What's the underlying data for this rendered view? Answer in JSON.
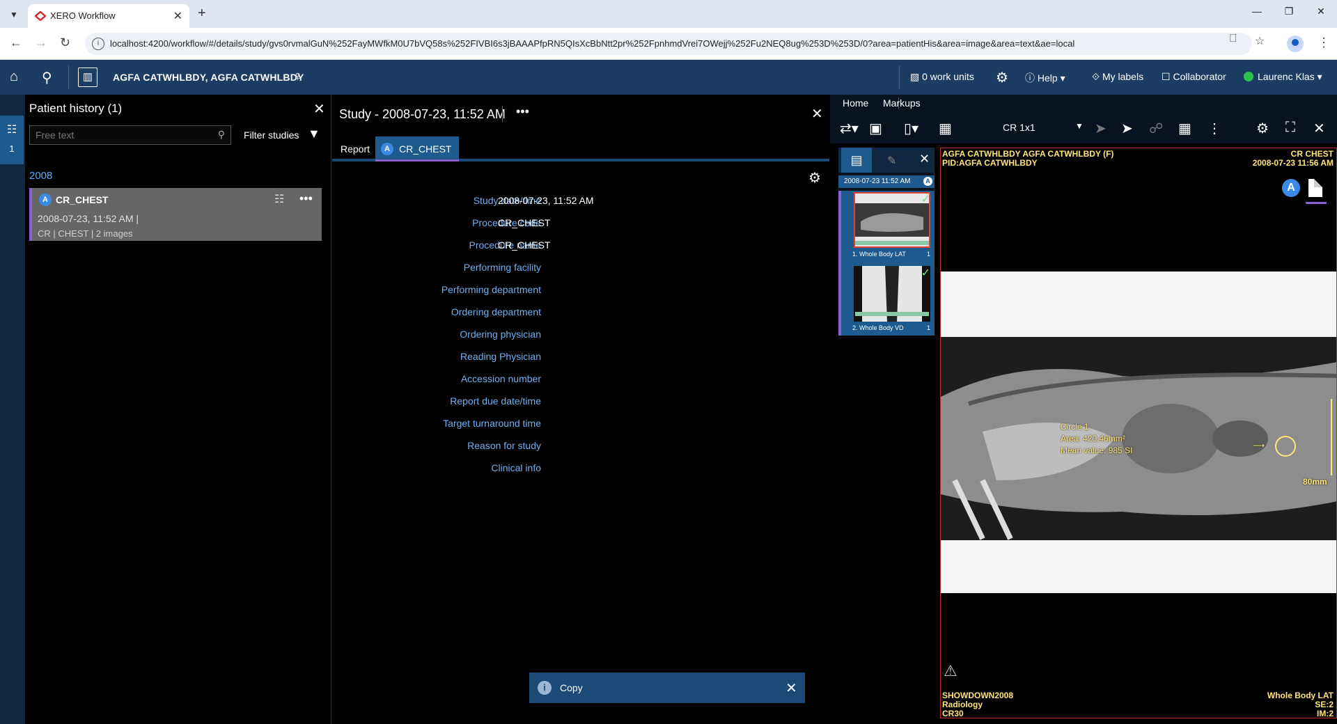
{
  "browser": {
    "tab_title": "XERO Workflow",
    "url": "localhost:4200/workflow/#/details/study/gvs0rvmalGuN%252FayMWfkM0U7bVQ58s%252FIVBI6s3jBAAAPfpRN5QIsXcBbNtt2pr%252FpnhmdVrei7OWejj%252Fu2NEQ8ug%253D%253D/0?area=patientHis&area=image&area=text&ae=local"
  },
  "header": {
    "patient_name": "AGFA CATWHLBDY, AGFA CATWHLBDY",
    "work_units": "0 work units",
    "help": "Help",
    "my_labels": "My labels",
    "collaborator": "Collaborator",
    "user": "Laurenc Klas"
  },
  "rail": {
    "count": "1"
  },
  "history": {
    "title": "Patient history (1)",
    "search_placeholder": "Free text",
    "filter_label": "Filter studies",
    "year": "2008",
    "study": {
      "badge": "A",
      "name": "CR_CHEST",
      "date": "2008-07-23, 11:52 AM |",
      "meta": "CR | CHEST | 2 images"
    }
  },
  "study": {
    "title": "Study - 2008-07-23, 11:52 AM",
    "tab_report": "Report",
    "tab_badge": "A",
    "tab_name": "CR_CHEST",
    "fields": [
      {
        "label": "Study date/time",
        "value": "2008-07-23, 11:52 AM"
      },
      {
        "label": "Procedure code",
        "value": "CR_CHEST"
      },
      {
        "label": "Procedure name",
        "value": "CR_CHEST"
      },
      {
        "label": "Performing facility",
        "value": ""
      },
      {
        "label": "Performing department",
        "value": ""
      },
      {
        "label": "Ordering department",
        "value": ""
      },
      {
        "label": "Ordering physician",
        "value": ""
      },
      {
        "label": "Reading Physician",
        "value": ""
      },
      {
        "label": "Accession number",
        "value": ""
      },
      {
        "label": "Report due date/time",
        "value": ""
      },
      {
        "label": "Target turnaround time",
        "value": ""
      },
      {
        "label": "Reason for study",
        "value": ""
      },
      {
        "label": "Clinical info",
        "value": ""
      }
    ],
    "toast": "Copy"
  },
  "viewer": {
    "menu_home": "Home",
    "menu_markups": "Markups",
    "layout": "CR 1x1",
    "thumb_date": "2008-07-23 11:52 AM",
    "thumb_badge": "A",
    "thumbs": [
      {
        "label": "1. Whole Body LAT",
        "count": "1"
      },
      {
        "label": "2. Whole Body VD",
        "count": "1"
      }
    ],
    "overlay": {
      "top_left_1": "AGFA CATWHLBDY AGFA CATWHLBDY  (F)",
      "top_left_2": "PID:AGFA CATWHLBDY",
      "top_right_1": "CR  CHEST",
      "top_right_2": "2008-07-23 11:56 AM",
      "badge": "A",
      "bottom_left_1": "SHOWDOWN2008",
      "bottom_left_2": "Radiology",
      "bottom_left_3": "CR30",
      "bottom_right_1": "Whole Body LAT",
      "bottom_right_2": "SE:2",
      "bottom_right_3": "IM:2"
    },
    "annotation": {
      "name": "Circle 1",
      "area": "Area: 420.46mm²",
      "mean": "Mean value: 985 SI",
      "ruler": "80mm"
    }
  }
}
